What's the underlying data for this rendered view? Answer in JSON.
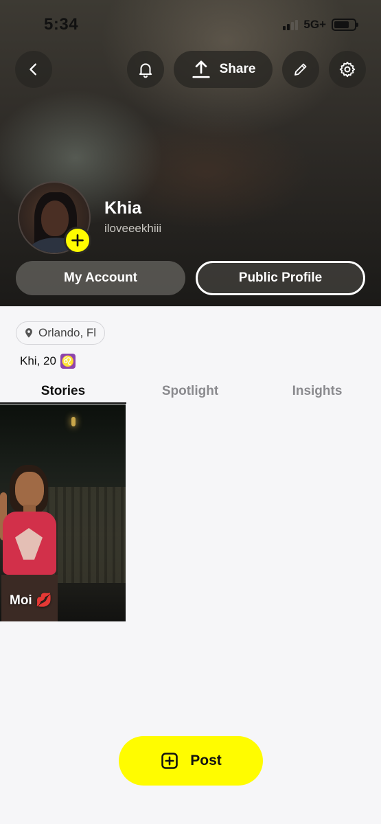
{
  "status_bar": {
    "time": "5:34",
    "network": "5G+"
  },
  "header": {
    "share_label": "Share"
  },
  "profile": {
    "display_name": "Khia",
    "username": "iloveeekhiii"
  },
  "buttons": {
    "my_account": "My Account",
    "public_profile": "Public Profile"
  },
  "info": {
    "location": "Orlando, Fl",
    "bio": "Khi, 20",
    "zodiac_symbol": "♌"
  },
  "tabs": [
    {
      "label": "Stories",
      "active": true
    },
    {
      "label": "Spotlight",
      "active": false
    },
    {
      "label": "Insights",
      "active": false
    }
  ],
  "stories": [
    {
      "caption": "Moi",
      "emoji": "💋"
    }
  ],
  "post_button": {
    "label": "Post"
  },
  "colors": {
    "accent_yellow": "#fffc00",
    "background": "#f6f6f8",
    "active_tab": "#111111",
    "inactive_tab": "#8a8a8e"
  }
}
